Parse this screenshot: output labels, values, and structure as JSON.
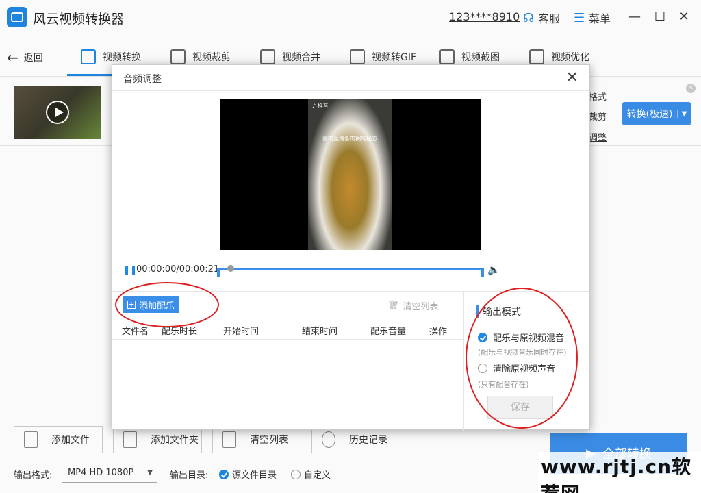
{
  "app": {
    "title": "风云视频转换器",
    "phone": "123****8910",
    "service": "客服",
    "menu": "菜单",
    "minimize": "—",
    "maximize": "☐",
    "close": "✕"
  },
  "toolbar": {
    "back": "返回",
    "tabs": [
      {
        "label": "视频转换",
        "icon": "video-convert-icon"
      },
      {
        "label": "视频裁剪",
        "icon": "video-crop-icon"
      },
      {
        "label": "视频合并",
        "icon": "video-merge-icon"
      },
      {
        "label": "视频转GIF",
        "icon": "gif-icon"
      },
      {
        "label": "视频截图",
        "icon": "screenshot-icon"
      },
      {
        "label": "视频优化",
        "icon": "optimize-icon"
      }
    ]
  },
  "file_row": {
    "links": [
      "格式",
      "裁剪",
      "调整"
    ],
    "convert_button": "转换(极速)"
  },
  "bottom": {
    "add_file": "添加文件",
    "add_folder": "添加文件夹",
    "clear_list": "清空列表",
    "history": "历史记录",
    "convert_all": "全部转换",
    "format_label": "输出格式:",
    "format_value": "MP4 HD 1080P",
    "dir_label": "输出目录:",
    "dir_source": "源文件目录",
    "dir_custom": "自定义"
  },
  "dialog": {
    "title": "音频调整",
    "close": "✕",
    "video_caption": "酱肉丝海条肉糊的秘方",
    "video_brand": "♪ 抖音",
    "time": "00:00:00/00:00:21",
    "progress": 0.0,
    "add_music": "添加配乐",
    "clear_list": "清空列表",
    "columns": [
      "文件名",
      "配乐时长",
      "开始时间",
      "结束时间",
      "配乐音量",
      "操作"
    ],
    "output_mode_title": "输出模式",
    "option_mix": "配乐与原视频混音",
    "option_mix_hint": "(配乐与视频音乐同时存在)",
    "option_clear": "清除原视频声音",
    "option_clear_hint": "(只有配音存在)",
    "save": "保存"
  },
  "watermark": "www.rjtj.cn软荐网"
}
